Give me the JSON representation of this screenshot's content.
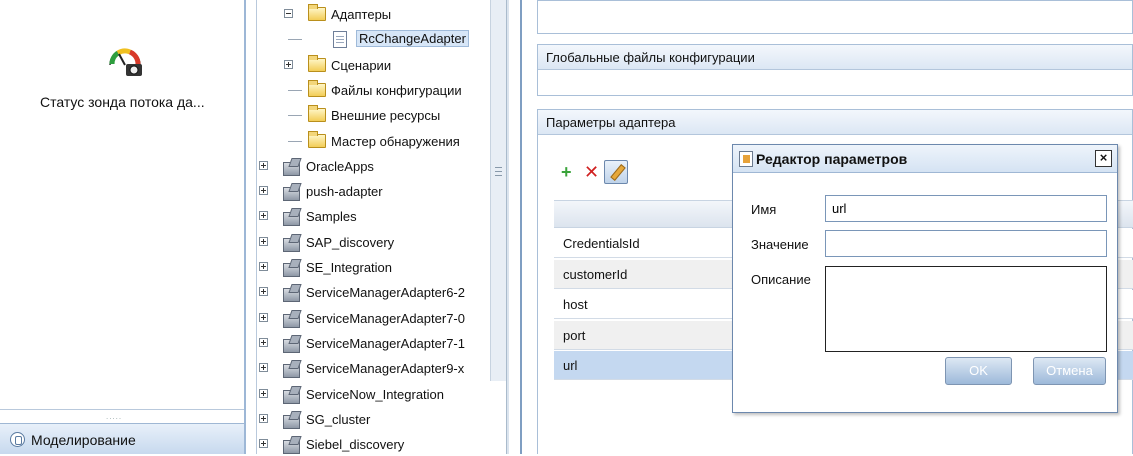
{
  "left_panel": {
    "module_label": "Статус зонда потока да...",
    "splitter_dots": ".....",
    "modeling_label": "Моделирование",
    "icons": {
      "module": "gauge-camera-icon",
      "modeling": "modeling-icon"
    }
  },
  "tree": {
    "items": [
      {
        "label": "Адаптеры",
        "icon": "folder-icon",
        "expander": "minus"
      },
      {
        "label": "RcChangeAdapter",
        "icon": "document-icon",
        "selected": true
      },
      {
        "label": "Сценарии",
        "icon": "folder-icon",
        "expander": "plus"
      },
      {
        "label": "Файлы конфигурации",
        "icon": "folder-icon"
      },
      {
        "label": "Внешние ресурсы",
        "icon": "folder-icon"
      },
      {
        "label": "Мастер обнаружения",
        "icon": "folder-icon"
      },
      {
        "label": "OracleApps",
        "icon": "package-icon",
        "expander": "plus"
      },
      {
        "label": "push-adapter",
        "icon": "package-icon",
        "expander": "plus"
      },
      {
        "label": "Samples",
        "icon": "package-icon",
        "expander": "plus"
      },
      {
        "label": "SAP_discovery",
        "icon": "package-icon",
        "expander": "plus"
      },
      {
        "label": "SE_Integration",
        "icon": "package-icon",
        "expander": "plus"
      },
      {
        "label": "ServiceManagerAdapter6-2",
        "icon": "package-icon",
        "expander": "plus"
      },
      {
        "label": "ServiceManagerAdapter7-0",
        "icon": "package-icon",
        "expander": "plus"
      },
      {
        "label": "ServiceManagerAdapter7-1",
        "icon": "package-icon",
        "expander": "plus"
      },
      {
        "label": "ServiceManagerAdapter9-x",
        "icon": "package-icon",
        "expander": "plus"
      },
      {
        "label": "ServiceNow_Integration",
        "icon": "package-icon",
        "expander": "plus"
      },
      {
        "label": "SG_cluster",
        "icon": "package-icon",
        "expander": "plus"
      },
      {
        "label": "Siebel_discovery",
        "icon": "package-icon",
        "expander": "plus"
      }
    ]
  },
  "content": {
    "global_config_title": "Глобальные файлы конфигурации",
    "adapter_params_title": "Параметры адаптера",
    "toolbar": {
      "add": "+",
      "delete": "✕",
      "edit_icon": "pencil-icon"
    },
    "params": [
      "CredentialsId",
      "customerId",
      "host",
      "port",
      "url"
    ],
    "selected_param": "url"
  },
  "dialog": {
    "title": "Редактор параметров",
    "close_glyph": "×",
    "name_label": "Имя",
    "name_value": "url",
    "value_label": "Значение",
    "value_value": "",
    "description_label": "Описание",
    "ok_label": "OK",
    "cancel_label": "Отмена"
  },
  "colors": {
    "panel_border": "#7f9ec2",
    "selection": "#c4d8f0",
    "header_gradient_top": "#f3f7fc",
    "header_gradient_bottom": "#dce7f4"
  }
}
